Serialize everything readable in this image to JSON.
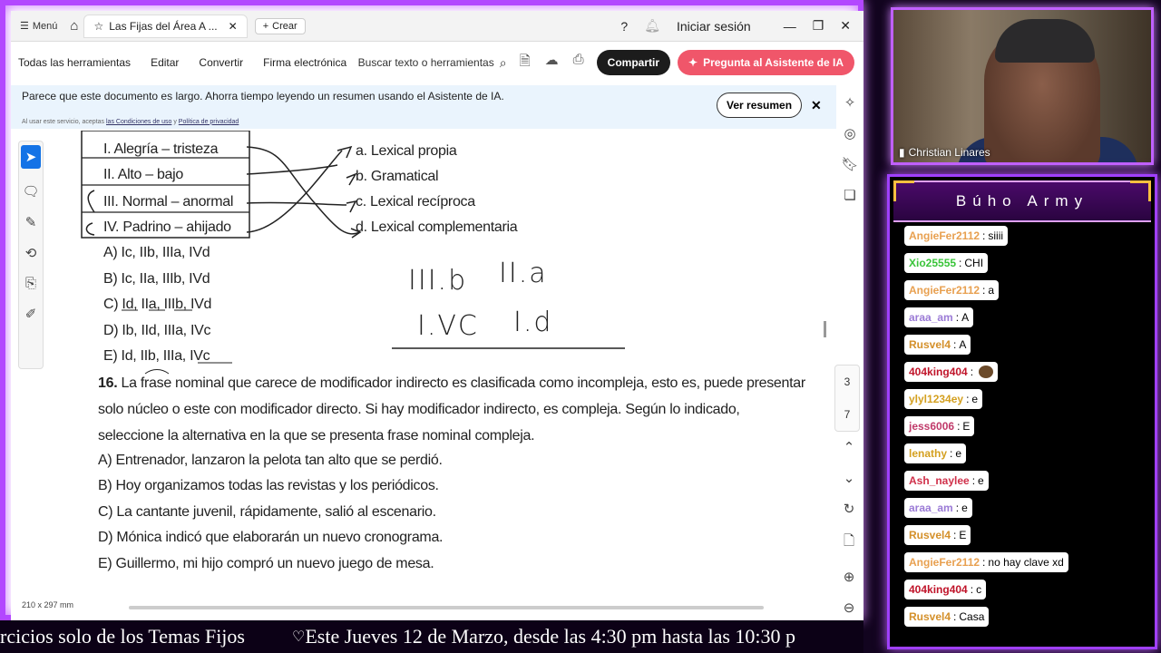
{
  "acrobat": {
    "menu_label": "Menú",
    "tab_title": "Las Fijas del Área A ...",
    "new_tab_label": "Crear",
    "signin": "Iniciar sesión",
    "tools": [
      "Todas las herramientas",
      "Editar",
      "Convertir",
      "Firma electrónica"
    ],
    "search_placeholder": "Buscar texto o herramientas",
    "share_label": "Compartir",
    "ai_label": "Pregunta al Asistente de IA",
    "banner_text": "Parece que este documento es largo. Ahorra tiempo leyendo un resumen usando el Asistente de IA.",
    "banner_sub_prefix": "Al usar este servicio, aceptas ",
    "banner_terms": "las Condiciones de uso",
    "banner_and": " y ",
    "banner_privacy": "Política de privacidad",
    "view_summary": "Ver resumen",
    "page_current": "3",
    "page_total": "7",
    "page_size": "210 x 297 mm"
  },
  "document": {
    "left_items": [
      "I. Alegría – tristeza",
      "II. Alto – bajo",
      "III. Normal – anormal",
      "IV. Padrino – ahijado"
    ],
    "right_items": [
      "a. Lexical propia",
      "b. Gramatical",
      "c. Lexical recíproca",
      "d. Lexical complementaria"
    ],
    "q15_options": [
      "A) Ic, IIb, IIIa, IVd",
      "B) Ic, IIa, IIIb, IVd",
      "C) Id, IIa, IIIb, IVd",
      "D) Ib, IId, IIIa, IVc",
      "E) Id, IIb, IIIa, IVc"
    ],
    "q16_number": "16.",
    "q16_text": "La frase nominal que carece de modificador indirecto es clasificada como incompleja, esto es, puede presentar solo núcleo o este con modificador directo. Si hay modificador indirecto, es compleja. Según lo indicado, seleccione la alternativa en la que se presenta frase nominal compleja.",
    "q16_options": [
      "A) Entrenador, lanzaron la pelota tan alto que se perdió.",
      "B) Hoy organizamos todas las revistas y los periódicos.",
      "C) La cantante juvenil, rápidamente, salió al escenario.",
      "D) Mónica indicó que elaborarán un nuevo cronograma.",
      "E) Guillermo, mi hijo compró un nuevo juego de mesa."
    ],
    "handwriting": [
      "III.b",
      "II.a",
      "I.VC",
      "I.d"
    ]
  },
  "ticker": {
    "text1": "rcicios solo de los Temas Fijos",
    "text2": "Este Jueves 12 de Marzo, desde las 4:30 pm hasta las 10:30 p"
  },
  "camera": {
    "name": "Christian Linares"
  },
  "chat": {
    "title": "Búho Army",
    "messages": [
      {
        "user": "AngieFer2112",
        "text": "siiii",
        "color": "#e8a050"
      },
      {
        "user": "Xio25555",
        "text": "CHI",
        "color": "#3ac43a"
      },
      {
        "user": "AngieFer2112",
        "text": "a",
        "color": "#e8a050"
      },
      {
        "user": "araa_am",
        "text": "A",
        "color": "#9b7bd6"
      },
      {
        "user": "Rusvel4",
        "text": "A",
        "color": "#d4902a"
      },
      {
        "user": "404king404",
        "text": "",
        "color": "#c0142a",
        "emoji": true
      },
      {
        "user": "ylyl1234ey",
        "text": "e",
        "color": "#d4a020"
      },
      {
        "user": "jess6006",
        "text": "E",
        "color": "#c03a6a"
      },
      {
        "user": "lenathy",
        "text": "e",
        "color": "#d4a020"
      },
      {
        "user": "Ash_naylee",
        "text": "e",
        "color": "#d0304a"
      },
      {
        "user": "araa_am",
        "text": "e",
        "color": "#9b7bd6"
      },
      {
        "user": "Rusvel4",
        "text": "E",
        "color": "#d4902a"
      },
      {
        "user": "AngieFer2112",
        "text": "no hay clave xd",
        "color": "#e8a050"
      },
      {
        "user": "404king404",
        "text": "c",
        "color": "#c0142a"
      },
      {
        "user": "Rusvel4",
        "text": "Casa",
        "color": "#d4902a"
      }
    ]
  }
}
